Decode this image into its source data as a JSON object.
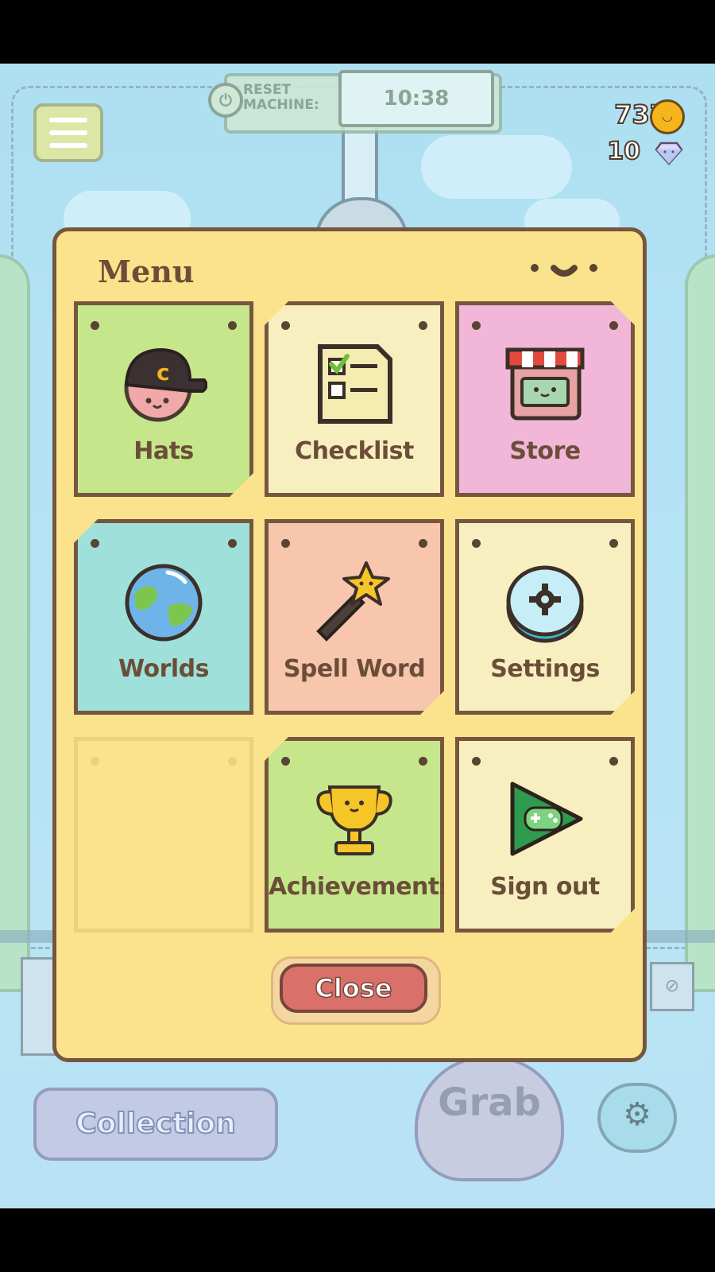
{
  "hud": {
    "reset_label_1": "RESET",
    "reset_label_2": "MACHINE:",
    "timer": "10:38",
    "coins": "737",
    "gems": "10",
    "coin_icon": "coin-icon",
    "gem_icon": "diamond-icon"
  },
  "background": {
    "collection_label": "Collection",
    "grab_label": "Grab"
  },
  "menu": {
    "title": "Menu",
    "tiles": [
      {
        "label": "Hats",
        "icon": "hat-character-icon"
      },
      {
        "label": "Checklist",
        "icon": "checklist-icon"
      },
      {
        "label": "Store",
        "icon": "store-icon"
      },
      {
        "label": "Worlds",
        "icon": "globe-icon"
      },
      {
        "label": "Spell Word",
        "icon": "magic-wand-icon"
      },
      {
        "label": "Settings",
        "icon": "gear-icon"
      },
      {
        "label": "",
        "icon": ""
      },
      {
        "label": "Achievements",
        "icon": "trophy-icon"
      },
      {
        "label": "Sign out",
        "icon": "play-games-controller-icon"
      }
    ],
    "close_label": "Close"
  },
  "colors": {
    "panel": "#fbe38d",
    "border": "#76563f",
    "tile_green": "#c6e68c",
    "tile_cream": "#f8efc0",
    "tile_pink": "#f2b6d9",
    "tile_teal": "#9fe0da",
    "tile_salmon": "#f7c6ad",
    "close_button": "#d9706a"
  }
}
